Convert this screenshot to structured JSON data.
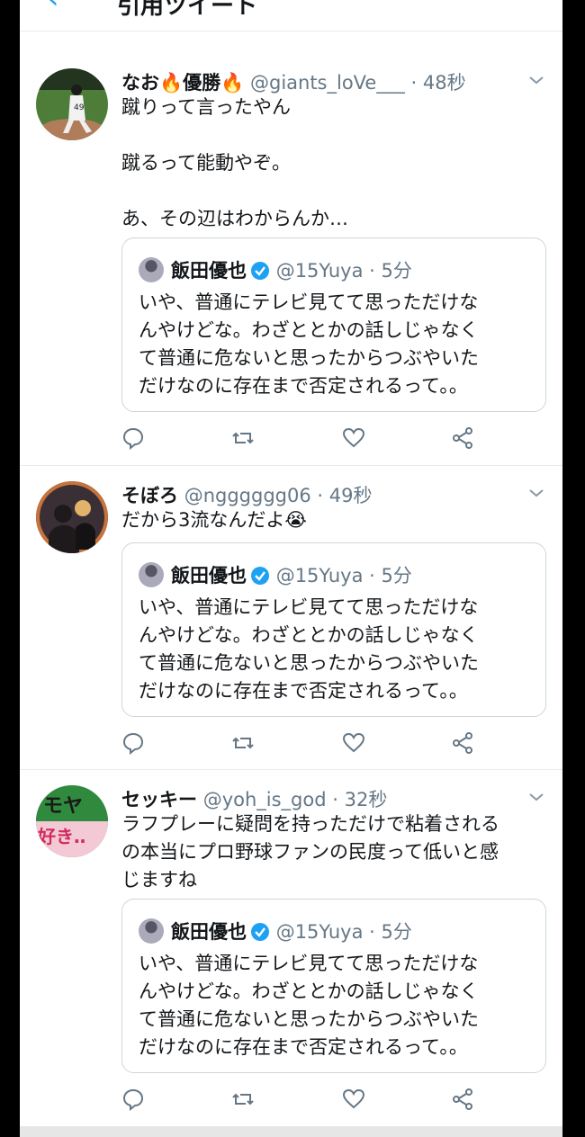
{
  "header": {
    "back_glyph": "‹",
    "title": "引用ツイート"
  },
  "tweets": [
    {
      "name": "なお🔥優勝🔥",
      "handle": "@giants_loVe___",
      "time": "48秒",
      "lines": [
        "蹴りって言ったやん",
        "",
        "蹴るって能動やぞ。",
        "",
        "あ、その辺はわからんか…"
      ]
    },
    {
      "name": "そぼろ",
      "handle": "@ngggggg06",
      "time": "49秒",
      "lines": [
        "だから3流なんだよ😭"
      ]
    },
    {
      "name": "セッキー",
      "handle": "@yoh_is_god",
      "time": "32秒",
      "lines": [
        "ラフプレーに疑問を持っただけで粘着される",
        "の本当にプロ野球ファンの民度って低いと感",
        "じますね"
      ]
    }
  ],
  "quoted": {
    "name": "飯田優也",
    "handle": "@15Yuya",
    "time": "5分",
    "lines": [
      "いや、普通にテレビ見てて思っただけな",
      "んやけどな。わざととかの話しじゃなく",
      "て普通に危ないと思ったからつぶやいた",
      "だけなのに存在まで否定されるって。。"
    ]
  },
  "sep": "·",
  "avatar3_text": [
    "モヤ",
    "好き‥"
  ],
  "colors": {
    "accent": "#1da1f2",
    "muted": "#657786",
    "border": "#e6ecf0"
  }
}
